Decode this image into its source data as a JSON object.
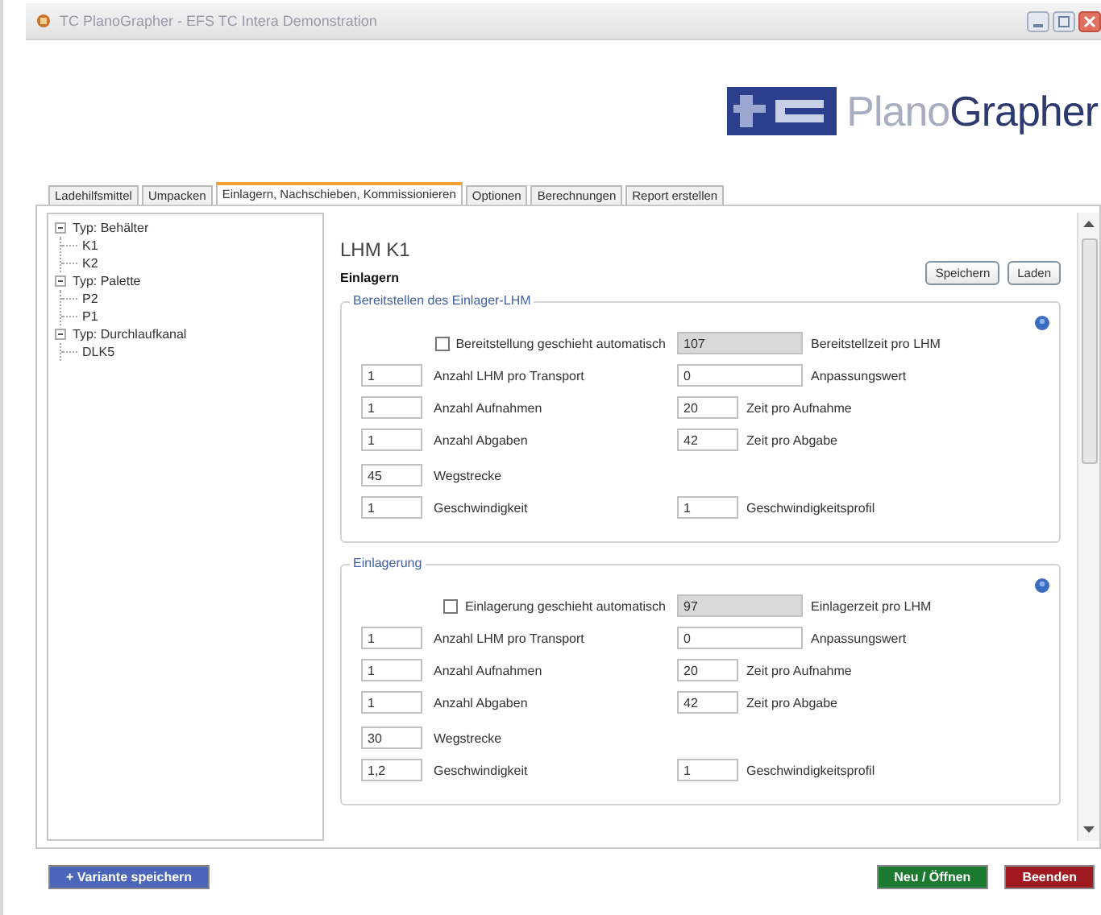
{
  "window": {
    "title": "TC PlanoGrapher - EFS TC Intera Demonstration"
  },
  "logo": {
    "light": "Plano",
    "dark": "Grapher"
  },
  "tabs": [
    {
      "label": "Ladehilfsmittel",
      "selected": false
    },
    {
      "label": "Umpacken",
      "selected": false
    },
    {
      "label": "Einlagern, Nachschieben, Kommissionieren",
      "selected": true
    },
    {
      "label": "Optionen",
      "selected": false
    },
    {
      "label": "Berechnungen",
      "selected": false
    },
    {
      "label": "Report erstellen",
      "selected": false
    }
  ],
  "tree": [
    {
      "label": "Typ: Behälter",
      "expanded": true,
      "children": [
        {
          "label": "K1"
        },
        {
          "label": "K2"
        }
      ]
    },
    {
      "label": "Typ: Palette",
      "expanded": true,
      "children": [
        {
          "label": "P2"
        },
        {
          "label": "P1"
        }
      ]
    },
    {
      "label": "Typ: Durchlaufkanal",
      "expanded": true,
      "children": [
        {
          "label": "DLK5"
        }
      ]
    }
  ],
  "heading": "LHM  K1",
  "subheading": "Einlagern",
  "actions": [
    "Speichern",
    "Laden"
  ],
  "sections": [
    {
      "title": "Bereitstellen des Einlager-LHM",
      "checkbox": {
        "label": "Bereitstellung geschieht automatisch",
        "checked": false
      },
      "auto_value": "107",
      "auto_label": "Bereitstellzeit pro LHM",
      "rows": [
        {
          "kind": "pair-wide",
          "value": "1",
          "label": "Anzahl LHM pro Transport",
          "value2": "0",
          "label2": "Anpassungswert"
        },
        {
          "kind": "pair",
          "value": "1",
          "label": "Anzahl Aufnahmen",
          "value2": "20",
          "label2": "Zeit pro Aufnahme"
        },
        {
          "kind": "pair",
          "value": "1",
          "label": "Anzahl Abgaben",
          "value2": "42",
          "label2": "Zeit pro Abgabe"
        },
        {
          "kind": "single",
          "value": "45",
          "label": "Wegstrecke"
        },
        {
          "kind": "pair",
          "value": "1",
          "label": "Geschwindigkeit",
          "value2": "1",
          "label2": "Geschwindigkeitsprofil"
        }
      ]
    },
    {
      "title": "Einlagerung",
      "checkbox": {
        "label": "Einlagerung geschieht automatisch",
        "checked": false
      },
      "auto_value": "97",
      "auto_label": "Einlagerzeit pro LHM",
      "rows": [
        {
          "kind": "pair-wide",
          "value": "1",
          "label": "Anzahl LHM pro Transport",
          "value2": "0",
          "label2": "Anpassungswert"
        },
        {
          "kind": "pair",
          "value": "1",
          "label": "Anzahl Aufnahmen",
          "value2": "20",
          "label2": "Zeit pro Aufnahme"
        },
        {
          "kind": "pair",
          "value": "1",
          "label": "Anzahl Abgaben",
          "value2": "42",
          "label2": "Zeit pro Abgabe"
        },
        {
          "kind": "single",
          "value": "30",
          "label": "Wegstrecke"
        },
        {
          "kind": "pair",
          "value": "1,2",
          "label": "Geschwindigkeit",
          "value2": "1",
          "label2": "Geschwindigkeitsprofil"
        }
      ]
    }
  ],
  "footer": {
    "save_variant": "+ Variante speichern",
    "new_open": "Neu / Öffnen",
    "quit": "Beenden"
  }
}
